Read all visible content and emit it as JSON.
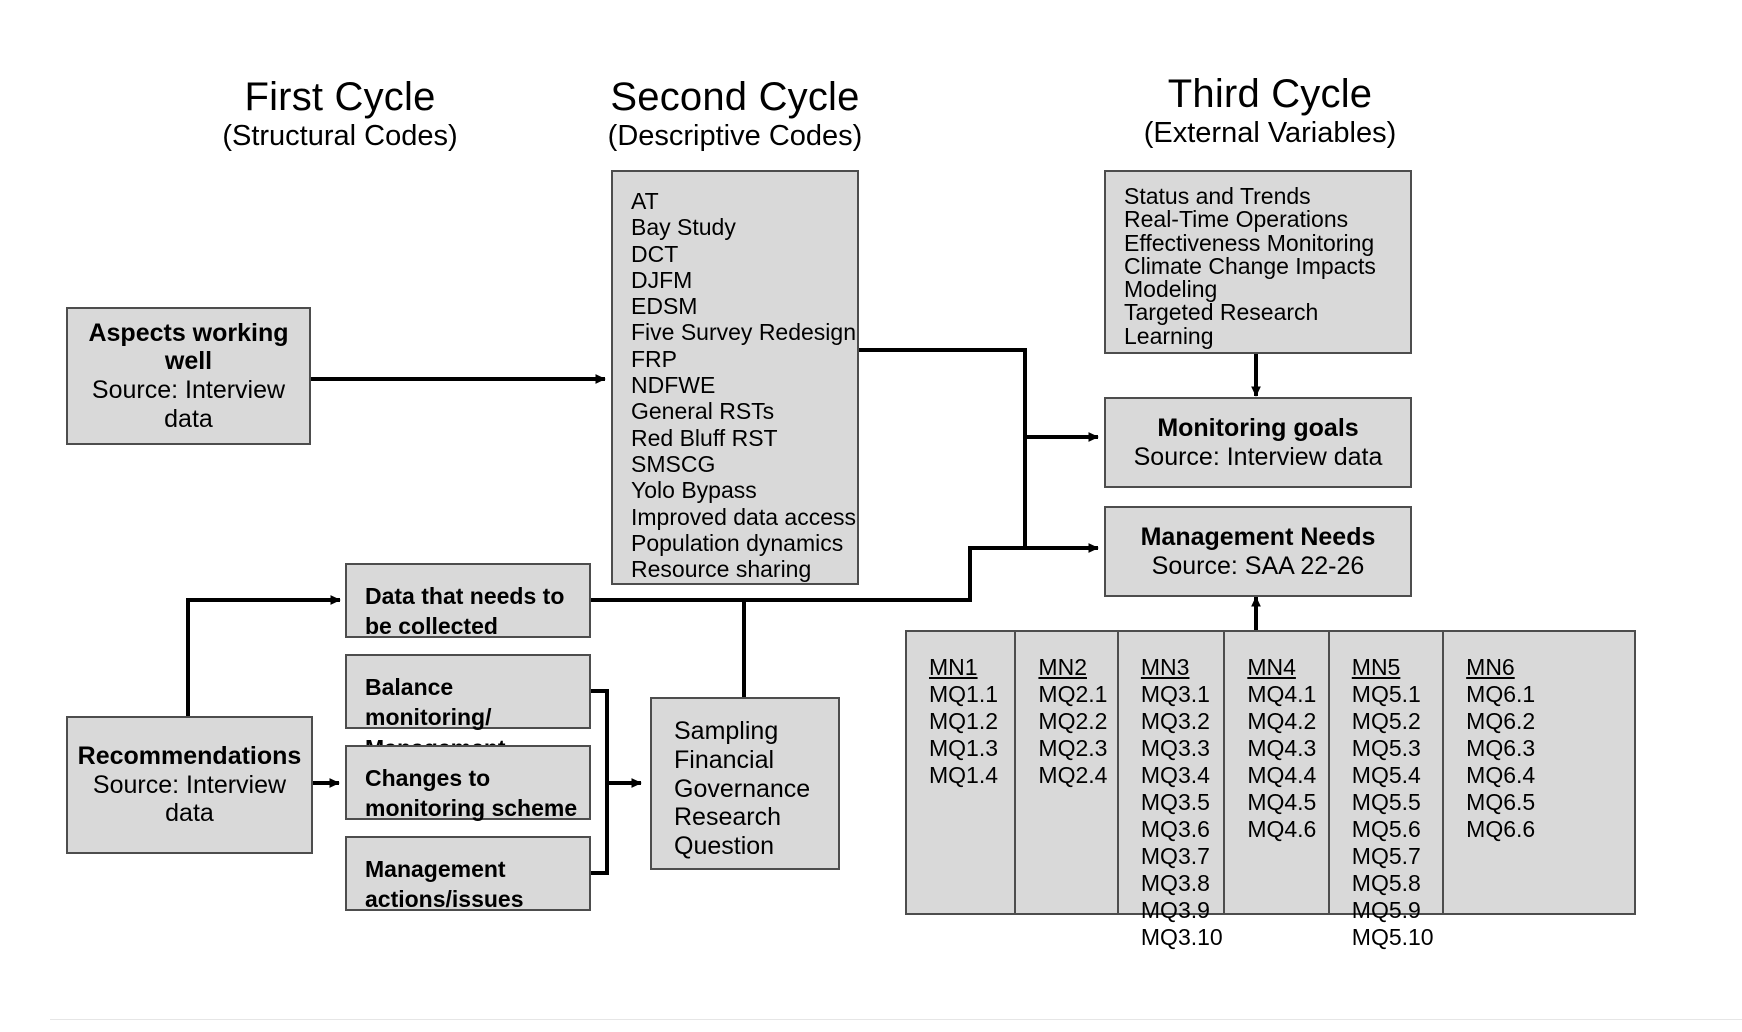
{
  "headers": [
    {
      "title": "First Cycle",
      "subtitle": "(Structural Codes)"
    },
    {
      "title": "Second Cycle",
      "subtitle": "(Descriptive Codes)"
    },
    {
      "title": "Third Cycle",
      "subtitle": "(External Variables)"
    }
  ],
  "boxes": {
    "aspects": {
      "title": "Aspects working well",
      "subtitle": "Source: Interview data"
    },
    "recommendations": {
      "title": "Recommendations",
      "subtitle": "Source: Interview data"
    },
    "data_needed": {
      "label": "Data that needs to be collected"
    },
    "balance": {
      "label": "Balance monitoring/ Management"
    },
    "changes": {
      "label": "Changes to monitoring scheme"
    },
    "mgmt_actions": {
      "label": "Management actions/issues"
    },
    "monitoring_goals": {
      "title": "Monitoring goals",
      "subtitle": "Source: Interview data"
    },
    "management_needs": {
      "title": "Management Needs",
      "subtitle": "Source: SAA 22-26"
    }
  },
  "descriptive_codes": [
    "AT",
    "Bay Study",
    "DCT",
    "DJFM",
    "EDSM",
    "Five Survey Redesign",
    "FRP",
    "NDFWE",
    "General RSTs",
    "Red Bluff RST",
    "SMSCG",
    "Yolo Bypass",
    "Improved data access",
    "Population dynamics",
    "Resource sharing"
  ],
  "external_variables": [
    "Status and Trends",
    "Real-Time Operations",
    "Effectiveness Monitoring",
    "Climate Change Impacts",
    "Modeling",
    "Targeted Research",
    "Learning"
  ],
  "sampling_categories": [
    "Sampling",
    "Financial",
    "Governance",
    "Research",
    "Question"
  ],
  "mn_columns": [
    {
      "header": "MN1",
      "items": [
        "MQ1.1",
        "MQ1.2",
        "MQ1.3",
        "MQ1.4"
      ]
    },
    {
      "header": "MN2",
      "items": [
        "MQ2.1",
        "MQ2.2",
        "MQ2.3",
        "MQ2.4"
      ]
    },
    {
      "header": "MN3",
      "items": [
        "MQ3.1",
        "MQ3.2",
        "MQ3.3",
        "MQ3.4",
        "MQ3.5",
        "MQ3.6",
        "MQ3.7",
        "MQ3.8",
        "MQ3.9",
        "MQ3.10"
      ]
    },
    {
      "header": "MN4",
      "items": [
        "MQ4.1",
        "MQ4.2",
        "MQ4.3",
        "MQ4.4",
        "MQ4.5",
        "MQ4.6"
      ]
    },
    {
      "header": "MN5",
      "items": [
        "MQ5.1",
        "MQ5.2",
        "MQ5.3",
        "MQ5.4",
        "MQ5.5",
        "MQ5.6",
        "MQ5.7",
        "MQ5.8",
        "MQ5.9",
        "MQ5.10"
      ]
    },
    {
      "header": "MN6",
      "items": [
        "MQ6.1",
        "MQ6.2",
        "MQ6.3",
        "MQ6.4",
        "MQ6.5",
        "MQ6.6"
      ]
    }
  ],
  "colors": {
    "box_fill": "#d9d9d9",
    "box_border": "#4d4d4d",
    "connector": "#000000",
    "page_background": "#ffffff"
  }
}
